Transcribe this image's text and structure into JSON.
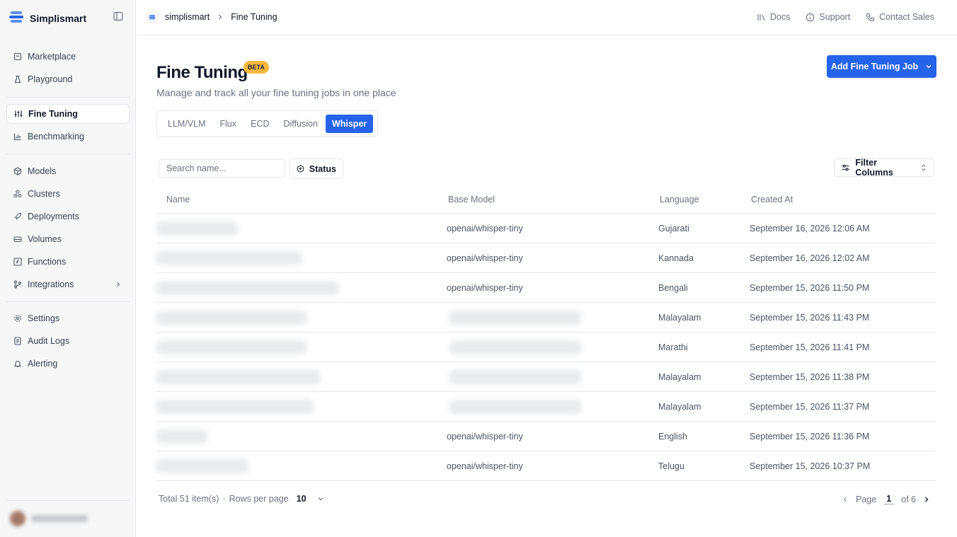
{
  "app": {
    "brand": "Simplismart"
  },
  "sidebar": {
    "groups": [
      [
        {
          "label": "Marketplace",
          "icon": "store-icon"
        },
        {
          "label": "Playground",
          "icon": "flask-icon"
        }
      ],
      [
        {
          "label": "Fine Tuning",
          "icon": "sliders-icon",
          "active": true
        },
        {
          "label": "Benchmarking",
          "icon": "bar-chart-icon"
        }
      ],
      [
        {
          "label": "Models",
          "icon": "cube-icon"
        },
        {
          "label": "Clusters",
          "icon": "cluster-icon"
        },
        {
          "label": "Deployments",
          "icon": "rocket-icon"
        },
        {
          "label": "Volumes",
          "icon": "drive-icon"
        },
        {
          "label": "Functions",
          "icon": "function-icon"
        },
        {
          "label": "Integrations",
          "icon": "branch-icon",
          "expandable": true
        }
      ],
      [
        {
          "label": "Settings",
          "icon": "gear-icon"
        },
        {
          "label": "Audit Logs",
          "icon": "logs-icon"
        },
        {
          "label": "Alerting",
          "icon": "bell-icon"
        }
      ]
    ]
  },
  "breadcrumb": {
    "org": "simplismart",
    "page": "Fine Tuning"
  },
  "top_links": {
    "docs": "Docs",
    "support": "Support",
    "contact": "Contact Sales"
  },
  "header": {
    "title": "Fine Tuning",
    "badge": "BETA",
    "subtitle": "Manage and track all your fine tuning jobs in one place",
    "add_button": "Add Fine Tuning Job"
  },
  "tabs": [
    "LLM/VLM",
    "Flux",
    "ECD",
    "Diffusion",
    "Whisper"
  ],
  "active_tab": "Whisper",
  "toolbar": {
    "search_placeholder": "Search name...",
    "status_label": "Status",
    "filter_label": "Filter Columns"
  },
  "table": {
    "columns": [
      "Name",
      "Base Model",
      "Language",
      "Created At"
    ],
    "rows": [
      {
        "name_redacted": true,
        "base_model": "openai/whisper-tiny",
        "base_model_redacted": false,
        "language": "Gujarati",
        "created_at": "September 16, 2026 12:06 AM"
      },
      {
        "name_redacted": true,
        "base_model": "openai/whisper-tiny",
        "base_model_redacted": false,
        "language": "Kannada",
        "created_at": "September 16, 2026 12:02 AM"
      },
      {
        "name_redacted": true,
        "base_model": "openai/whisper-tiny",
        "base_model_redacted": false,
        "language": "Bengali",
        "created_at": "September 15, 2026 11:50 PM"
      },
      {
        "name_redacted": true,
        "base_model": "",
        "base_model_redacted": true,
        "language": "Malayalam",
        "created_at": "September 15, 2026 11:43 PM"
      },
      {
        "name_redacted": true,
        "base_model": "",
        "base_model_redacted": true,
        "language": "Marathi",
        "created_at": "September 15, 2026 11:41 PM"
      },
      {
        "name_redacted": true,
        "base_model": "",
        "base_model_redacted": true,
        "language": "Malayalam",
        "created_at": "September 15, 2026 11:38 PM"
      },
      {
        "name_redacted": true,
        "base_model": "",
        "base_model_redacted": true,
        "language": "Malayalam",
        "created_at": "September 15, 2026 11:37 PM"
      },
      {
        "name_redacted": true,
        "base_model": "openai/whisper-tiny",
        "base_model_redacted": false,
        "language": "English",
        "created_at": "September 15, 2026 11:36 PM"
      },
      {
        "name_redacted": true,
        "base_model": "openai/whisper-tiny",
        "base_model_redacted": false,
        "language": "Telugu",
        "created_at": "September 15, 2026 10:37 PM"
      }
    ]
  },
  "pagination": {
    "total": "Total 51 item(s)",
    "dot": "·",
    "rows_per_page_label": "Rows per page",
    "rows_per_page": "10",
    "page_label": "Page",
    "page": "1",
    "of_label": "of 6"
  },
  "colors": {
    "accent": "#2563eb",
    "badge": "#f6b73c"
  }
}
